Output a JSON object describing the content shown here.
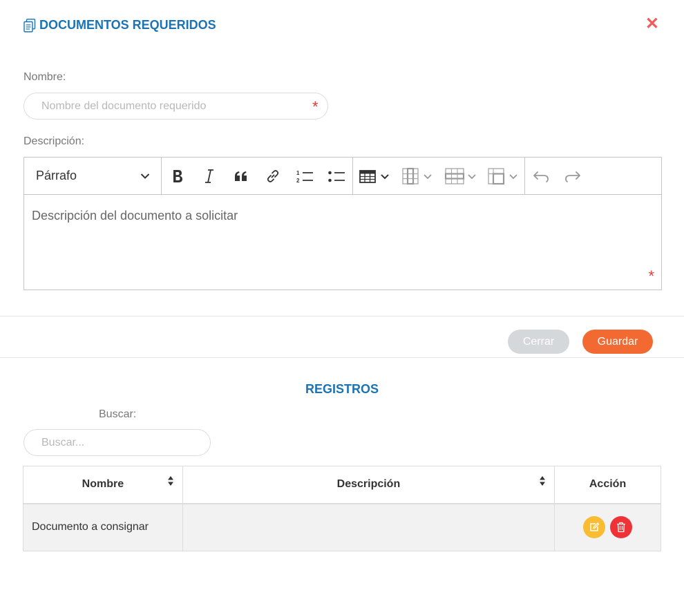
{
  "modal": {
    "title": "DOCUMENTOS REQUERIDOS",
    "close_glyph": "✕"
  },
  "form": {
    "nombre_label": "Nombre:",
    "nombre_placeholder": "Nombre del documento requerido",
    "nombre_value": "",
    "descripcion_label": "Descripción:",
    "descripcion_placeholder": "Descripción del documento a solicitar",
    "required_mark": "*"
  },
  "toolbar": {
    "paragraph_select": "Párrafo",
    "buttons": [
      "bold-icon",
      "italic-icon",
      "blockquote-icon",
      "link-icon",
      "numbered-list-icon",
      "bulleted-list-icon",
      "insert-table-icon",
      "table-column-icon",
      "table-row-icon",
      "merge-cells-icon",
      "undo-icon",
      "redo-icon"
    ]
  },
  "actions": {
    "cerrar_label": "Cerrar",
    "guardar_label": "Guardar"
  },
  "registros": {
    "heading": "REGISTROS",
    "search_label": "Buscar:",
    "search_placeholder": "Buscar...",
    "columns": [
      "Nombre",
      "Descripción",
      "Acción"
    ],
    "rows": [
      {
        "nombre": "Documento a consignar",
        "descripcion": ""
      }
    ]
  },
  "colors": {
    "title_blue": "#1a73b5",
    "close_red": "#f05a5a",
    "guardar_orange": "#f26a32",
    "cerrar_gray": "#d5d8da",
    "edit_yellow": "#f9bc32",
    "delete_red": "#ee3236"
  }
}
